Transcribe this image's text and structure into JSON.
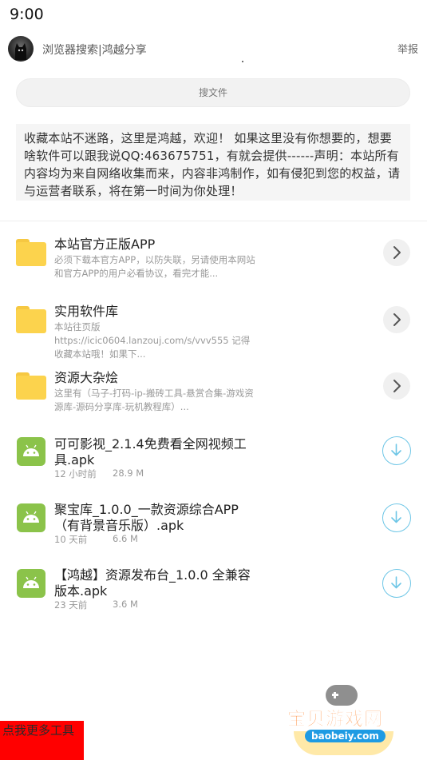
{
  "status_bar": {
    "time": "9:00"
  },
  "header": {
    "title": "浏览器搜索|鸿越分享",
    "report": "举报"
  },
  "search": {
    "placeholder": "搜文件"
  },
  "notice": "收藏本站不迷路，这里是鸿越，欢迎！ 如果这里没有你想要的，想要啥软件可以跟我说QQ:463675751，有就会提供------声明：本站所有内容均为来自网络收集而来，内容非鸿制作，如有侵犯到您的权益，请与运营者联系，将在第一时间为你处理！",
  "folders": [
    {
      "title": "本站官方正版APP",
      "desc": "必须下载本官方APP，以防失联，另请使用本网站和官方APP的用户必看协议，看完才能..."
    },
    {
      "title": "实用软件库",
      "desc": "本站往页版\nhttps://icic0604.lanzouj.com/s/vvv555 记得收藏本站哦！如果下..."
    },
    {
      "title": "资源大杂烩",
      "desc": "这里有（马子-打码-ip-搬砖工具-悬赏合集-游戏资源库-源码分享库-玩机教程库）..."
    }
  ],
  "files": [
    {
      "name": "可可影视_2.1.4免费看全网视频工具.apk",
      "time": "12 小时前",
      "size": "28.9 M"
    },
    {
      "name": "聚宝库_1.0.0_一款资源综合APP（有背景音乐版）.apk",
      "time": "10 天前",
      "size": "6.6 M"
    },
    {
      "name": "【鸿越】资源发布台_1.0.0 全兼容版本.apk",
      "time": "23 天前",
      "size": "3.6 M"
    }
  ],
  "footer": {
    "more_tools": "点我更多工具"
  },
  "watermark": {
    "title": "宝贝游戏网",
    "url": "baobeiy.com"
  },
  "colors": {
    "folder": "#fcd34d",
    "apk": "#8bc34a",
    "download_ring": "#6ec6e6",
    "more_tools_bg": "#ff0000"
  },
  "icons": {
    "folder": "folder-icon",
    "apk": "android-icon",
    "chevron": "chevron-right-icon",
    "download": "download-icon"
  }
}
